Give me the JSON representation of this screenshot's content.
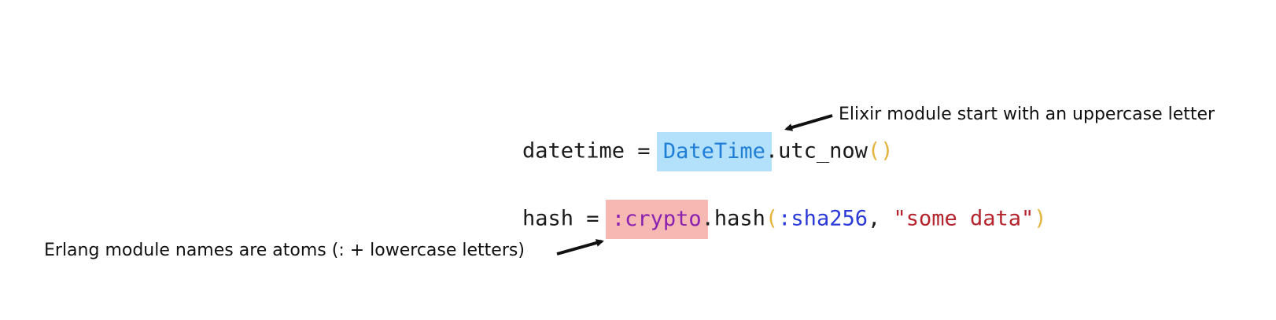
{
  "code": {
    "line1": {
      "var": "datetime",
      "op": " = ",
      "module": "DateTime",
      "dot": ".",
      "func": "utc_now",
      "open": "(",
      "close": ")"
    },
    "line2": {
      "var": "hash",
      "op": " = ",
      "module": ":crypto",
      "dot": ".",
      "func": "hash",
      "open": "(",
      "atom": ":sha256",
      "comma": ", ",
      "string": "\"some data\"",
      "close": ")"
    }
  },
  "annotations": {
    "elixir": "Elixir module start with an uppercase letter",
    "erlang": "Erlang module names are atoms (: + lowercase letters)"
  },
  "colors": {
    "elixir_highlight": "#b3e0fb",
    "erlang_highlight": "#f5b8b3",
    "elixir_module_text": "#1f7fd6",
    "erlang_module_text": "#8a1fb0",
    "paren": "#e4b33b",
    "atom": "#2b3ad8",
    "string": "#b5242c"
  }
}
